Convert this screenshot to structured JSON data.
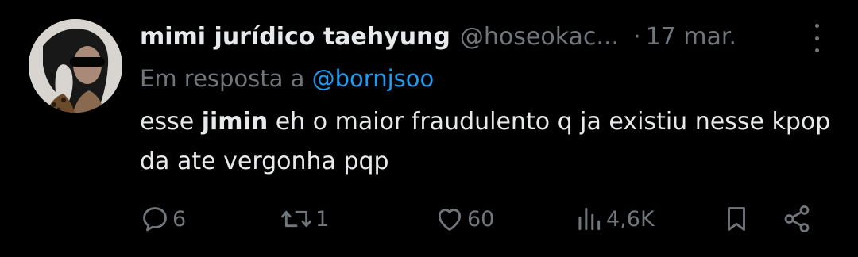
{
  "tweet": {
    "display_name": "mimi jurídico taehyung",
    "handle": "@hoseokac...",
    "separator": "·",
    "date": "17 mar.",
    "reply_prefix": "Em resposta a",
    "reply_to": "@bornjsoo",
    "text_before": "esse ",
    "text_bold": "jimin",
    "text_after": " eh o maior fraudulento q ja existiu nesse kpop da ate vergonha pqp"
  },
  "actions": {
    "replies": "6",
    "retweets": "1",
    "likes": "60",
    "views": "4,6K"
  },
  "icons": [
    "more-icon",
    "reply-icon",
    "retweet-icon",
    "like-icon",
    "views-icon",
    "bookmark-icon",
    "share-icon"
  ],
  "colors": {
    "background": "#000000",
    "text": "#e7e9ea",
    "muted": "#71767b",
    "link": "#1d9bf0"
  }
}
